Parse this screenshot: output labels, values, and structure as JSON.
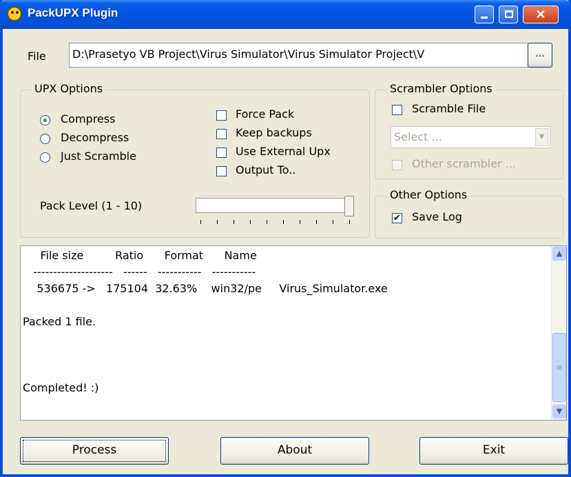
{
  "window": {
    "title": "PackUPX Plugin",
    "controls": {
      "minimize": "minimize",
      "maximize": "maximize",
      "close": "✕"
    }
  },
  "file": {
    "label": "File",
    "path_value": "D:\\Prasetyo VB Project\\Virus Simulator\\Virus Simulator Project\\V",
    "browse_label": "..."
  },
  "upx_options": {
    "legend": "UPX Options",
    "modes": [
      {
        "label": "Compress",
        "selected": true
      },
      {
        "label": "Decompress",
        "selected": false
      },
      {
        "label": "Just Scramble",
        "selected": false
      }
    ],
    "flags": [
      {
        "label": "Force Pack",
        "checked": false
      },
      {
        "label": "Keep backups",
        "checked": false
      },
      {
        "label": "Use External Upx",
        "checked": false
      },
      {
        "label": "Output To..",
        "checked": false
      }
    ],
    "pack_level_label": "Pack Level (1 - 10)",
    "pack_level_value": 10
  },
  "scrambler_options": {
    "legend": "Scrambler Options",
    "scramble_file_label": "Scramble File",
    "scramble_file_checked": false,
    "select_placeholder": "Select ...",
    "other_scrambler_label": "Other scrambler ...",
    "other_scrambler_enabled": false
  },
  "other_options": {
    "legend": "Other Options",
    "save_log_label": "Save Log",
    "save_log_checked": true
  },
  "log": {
    "lines": [
      "     File size         Ratio      Format      Name",
      "   --------------------   ------   -----------   -----------",
      "    536675 ->   175104  32.63%    win32/pe     Virus_Simulator.exe",
      "",
      "Packed 1 file.",
      "",
      "",
      "",
      "Completed! :)"
    ]
  },
  "buttons": {
    "process": "Process",
    "about": "About",
    "exit": "Exit"
  },
  "colors": {
    "titlebar": "#0553e1",
    "window_bg": "#ece9d8",
    "close_button": "#c8401d"
  }
}
